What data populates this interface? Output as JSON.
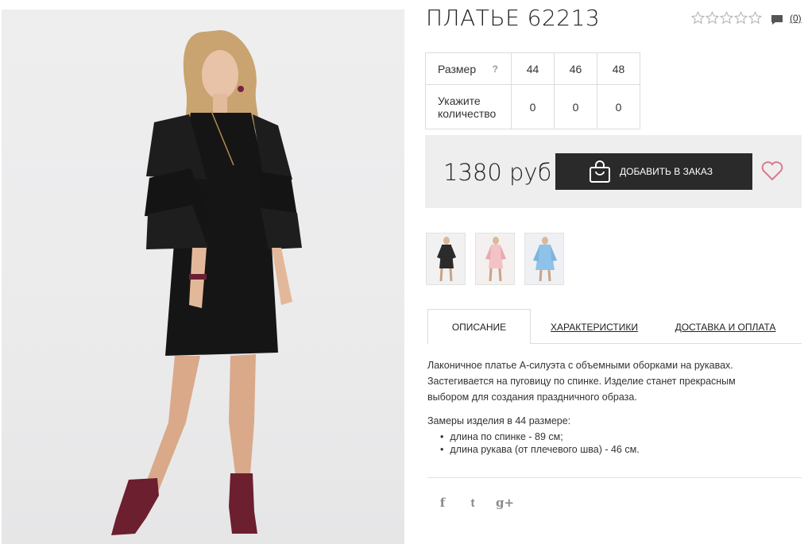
{
  "product": {
    "title": "ПЛАТЬЕ 62213",
    "rating_stars": 5,
    "rating_filled": 0,
    "review_count": "(0)"
  },
  "sizes": {
    "label": "Размер",
    "help": "?",
    "qty_label_1": "Укажите",
    "qty_label_2": "количество",
    "columns": [
      {
        "size": "44",
        "qty": "0"
      },
      {
        "size": "46",
        "qty": "0"
      },
      {
        "size": "48",
        "qty": "0"
      }
    ]
  },
  "purchase": {
    "price": "1380 руб",
    "add_button": "ДОБАВИТЬ В ЗАКАЗ"
  },
  "thumbnails": [
    {
      "color": "#2b2b2b",
      "name": "black"
    },
    {
      "color": "#f2c2c6",
      "name": "pink"
    },
    {
      "color": "#8fc2e8",
      "name": "blue"
    }
  ],
  "tabs": {
    "description": "ОПИСАНИЕ",
    "specs": "ХАРАКТЕРИСТИКИ",
    "delivery": "ДОСТАВКА И ОПЛАТА"
  },
  "description": {
    "text": "Лаконичное платье А-силуэта с объемными оборками на рукавах. Застегивается на пуговицу по спинке. Изделие станет прекрасным выбором для создания праздничного образа.",
    "measure_title": "Замеры изделия в 44 размере:",
    "measures": [
      "длина по спинке - 89 см;",
      "длина рукава (от плечевого шва) - 46 см."
    ]
  },
  "social": {
    "facebook": "f",
    "twitter": "t",
    "google": "g+"
  },
  "colors": {
    "dark": "#2a2a2a",
    "heart": "#d9788c",
    "panel": "#eeeeee"
  }
}
